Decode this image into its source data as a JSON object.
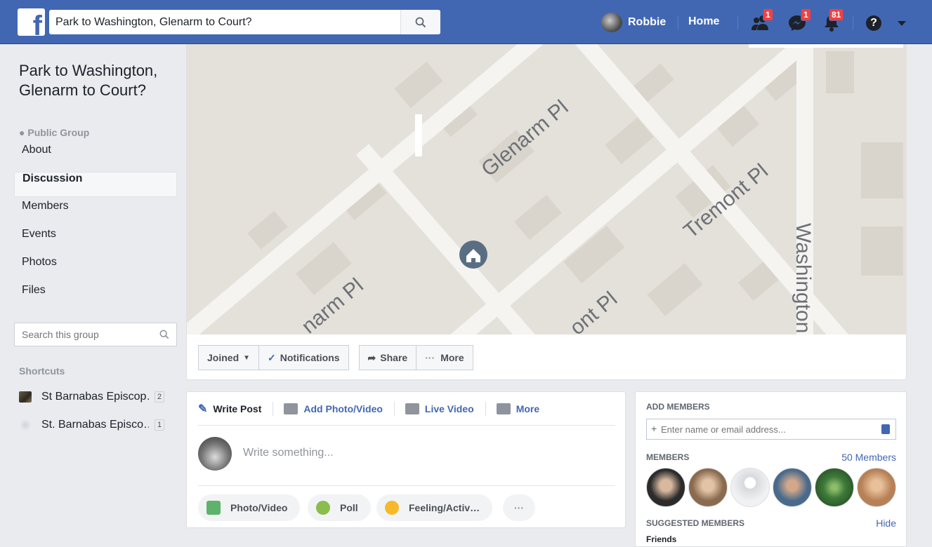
{
  "header": {
    "search_value": "Park to Washington, Glenarm to Court?",
    "user_name": "Robbie",
    "home_label": "Home",
    "friend_requests_count": "1",
    "messages_count": "1",
    "notifications_count": "81",
    "help_icon": "?"
  },
  "group": {
    "name": "Park to Washington, Glenarm to Court?",
    "type": "Public Group",
    "nav": [
      "About",
      "Discussion",
      "Members",
      "Events",
      "Photos",
      "Files"
    ],
    "active_nav": "Discussion",
    "search_placeholder": "Search this group",
    "shortcuts_title": "Shortcuts",
    "shortcuts": [
      {
        "label": "St Barnabas Episcop…",
        "count": "2"
      },
      {
        "label": "St. Barnabas Episco…",
        "count": "1"
      }
    ]
  },
  "map": {
    "streets": [
      "Glenarm Pl",
      "Tremont Pl",
      "Washington",
      "narm Pl",
      "ont Pl"
    ]
  },
  "cover_actions": {
    "joined": "Joined",
    "notifications": "Notifications",
    "share": "Share",
    "more": "More"
  },
  "composer": {
    "tabs": [
      "Write Post",
      "Add Photo/Video",
      "Live Video",
      "More"
    ],
    "placeholder": "Write something...",
    "options": [
      "Photo/Video",
      "Poll",
      "Feeling/Activ…"
    ],
    "more_options": "···"
  },
  "members_panel": {
    "add_title": "ADD MEMBERS",
    "add_placeholder": "Enter name or email address...",
    "members_title": "MEMBERS",
    "members_link": "50 Members",
    "suggested_title": "SUGGESTED MEMBERS",
    "hide_link": "Hide",
    "friends_label": "Friends"
  },
  "colors": {
    "brand_blue": "#4267b2",
    "badge_red": "#fa3e3e",
    "map_bg": "#e4e1da"
  }
}
